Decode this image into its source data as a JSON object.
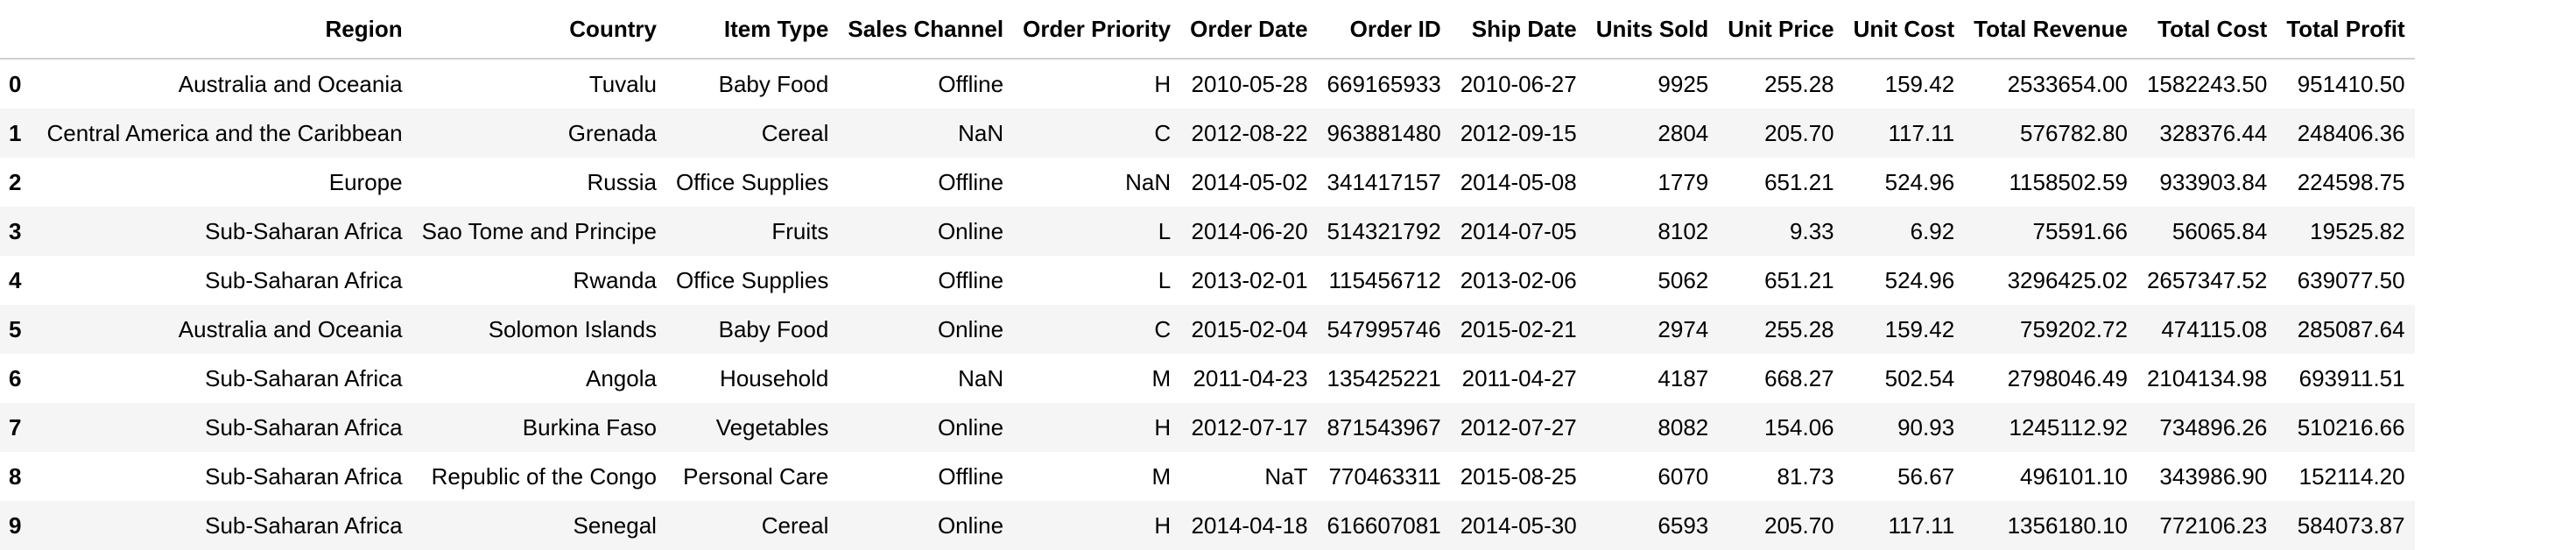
{
  "table": {
    "index_header": "",
    "columns": [
      "Region",
      "Country",
      "Item Type",
      "Sales Channel",
      "Order Priority",
      "Order Date",
      "Order ID",
      "Ship Date",
      "Units Sold",
      "Unit Price",
      "Unit Cost",
      "Total Revenue",
      "Total Cost",
      "Total Profit"
    ],
    "rows": [
      {
        "index": "0",
        "cells": [
          "Australia and Oceania",
          "Tuvalu",
          "Baby Food",
          "Offline",
          "H",
          "2010-05-28",
          "669165933",
          "2010-06-27",
          "9925",
          "255.28",
          "159.42",
          "2533654.00",
          "1582243.50",
          "951410.50"
        ]
      },
      {
        "index": "1",
        "cells": [
          "Central America and the Caribbean",
          "Grenada",
          "Cereal",
          "NaN",
          "C",
          "2012-08-22",
          "963881480",
          "2012-09-15",
          "2804",
          "205.70",
          "117.11",
          "576782.80",
          "328376.44",
          "248406.36"
        ]
      },
      {
        "index": "2",
        "cells": [
          "Europe",
          "Russia",
          "Office Supplies",
          "Offline",
          "NaN",
          "2014-05-02",
          "341417157",
          "2014-05-08",
          "1779",
          "651.21",
          "524.96",
          "1158502.59",
          "933903.84",
          "224598.75"
        ]
      },
      {
        "index": "3",
        "cells": [
          "Sub-Saharan Africa",
          "Sao Tome and Principe",
          "Fruits",
          "Online",
          "L",
          "2014-06-20",
          "514321792",
          "2014-07-05",
          "8102",
          "9.33",
          "6.92",
          "75591.66",
          "56065.84",
          "19525.82"
        ]
      },
      {
        "index": "4",
        "cells": [
          "Sub-Saharan Africa",
          "Rwanda",
          "Office Supplies",
          "Offline",
          "L",
          "2013-02-01",
          "115456712",
          "2013-02-06",
          "5062",
          "651.21",
          "524.96",
          "3296425.02",
          "2657347.52",
          "639077.50"
        ]
      },
      {
        "index": "5",
        "cells": [
          "Australia and Oceania",
          "Solomon Islands",
          "Baby Food",
          "Online",
          "C",
          "2015-02-04",
          "547995746",
          "2015-02-21",
          "2974",
          "255.28",
          "159.42",
          "759202.72",
          "474115.08",
          "285087.64"
        ]
      },
      {
        "index": "6",
        "cells": [
          "Sub-Saharan Africa",
          "Angola",
          "Household",
          "NaN",
          "M",
          "2011-04-23",
          "135425221",
          "2011-04-27",
          "4187",
          "668.27",
          "502.54",
          "2798046.49",
          "2104134.98",
          "693911.51"
        ]
      },
      {
        "index": "7",
        "cells": [
          "Sub-Saharan Africa",
          "Burkina Faso",
          "Vegetables",
          "Online",
          "H",
          "2012-07-17",
          "871543967",
          "2012-07-27",
          "8082",
          "154.06",
          "90.93",
          "1245112.92",
          "734896.26",
          "510216.66"
        ]
      },
      {
        "index": "8",
        "cells": [
          "Sub-Saharan Africa",
          "Republic of the Congo",
          "Personal Care",
          "Offline",
          "M",
          "NaT",
          "770463311",
          "2015-08-25",
          "6070",
          "81.73",
          "56.67",
          "496101.10",
          "343986.90",
          "152114.20"
        ]
      },
      {
        "index": "9",
        "cells": [
          "Sub-Saharan Africa",
          "Senegal",
          "Cereal",
          "Online",
          "H",
          "2014-04-18",
          "616607081",
          "2014-05-30",
          "6593",
          "205.70",
          "117.11",
          "1356180.10",
          "772106.23",
          "584073.87"
        ]
      }
    ]
  },
  "colors": {
    "header_border": "#d0d0d0",
    "stripe": "#f5f5f5"
  }
}
